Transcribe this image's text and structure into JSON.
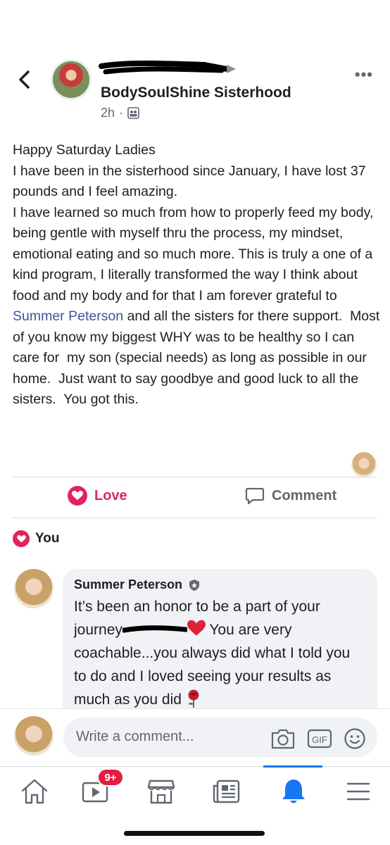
{
  "post": {
    "group_name": "BodySoulShine Sisterhood",
    "time": "2h",
    "separator": "·",
    "body_part1": "Happy Saturday Ladies\nI have been in the sisterhood since January, I have lost 37 pounds and I feel amazing.\nI have learned so much from how to properly feed my body,  being gentle with myself thru the process, my mindset, emotional eating and so much more. This is truly a one of a kind program, I literally transformed the way I think about food and my body and for that I am forever grateful to ",
    "mention": "Summer Peterson",
    "body_part2": " and all the sisters for there support.  Most of you know my biggest WHY was to be healthy so I can care for  my son (special needs) as long as possible in our home.  Just want to say goodbye and good luck to all the sisters.  You got this."
  },
  "actions": {
    "love_label": "Love",
    "comment_label": "Comment"
  },
  "reactions": {
    "label": "You"
  },
  "comment": {
    "author": "Summer Peterson",
    "text_part1": "It’s been an honor to be a part of your journey",
    "text_part2": " You are very coachable...you always did what I told you to do and I loved seeing your results as much as you did "
  },
  "composer": {
    "placeholder": "Write a comment...",
    "gif_label": "GIF"
  },
  "tabbar": {
    "video_badge": "9+",
    "active_tab": "notifications"
  },
  "colors": {
    "love": "#e0245e",
    "link": "#385898",
    "active": "#1877f2",
    "badge": "#e41e3f"
  },
  "icons": [
    "back-arrow-icon",
    "more-icon",
    "group-icon",
    "love-icon",
    "comment-icon",
    "verified-badge-icon",
    "heart-emoji-icon",
    "rose-emoji-icon",
    "camera-icon",
    "gif-icon",
    "smiley-icon",
    "home-icon",
    "video-icon",
    "marketplace-icon",
    "news-icon",
    "bell-icon",
    "menu-icon"
  ]
}
